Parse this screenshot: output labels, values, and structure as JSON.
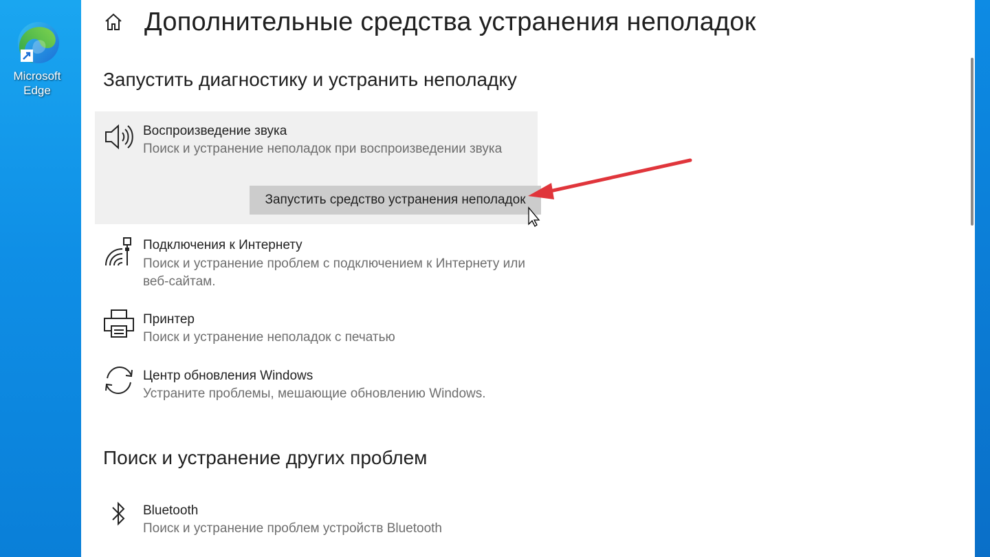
{
  "desktop": {
    "icon_label": "Microsoft Edge",
    "icon": "edge-logo-icon"
  },
  "header": {
    "title": "Дополнительные средства устранения неполадок",
    "home_icon": "home-icon"
  },
  "section_run": {
    "title": "Запустить диагностику и устранить неполадку"
  },
  "items": [
    {
      "icon": "speaker-icon",
      "title": "Воспроизведение звука",
      "description": "Поиск и устранение неполадок при воспроизведении звука",
      "selected": true,
      "button_label": "Запустить средство устранения неполадок"
    },
    {
      "icon": "network-icon",
      "title": "Подключения к Интернету",
      "description": "Поиск и устранение проблем с подключением к Интернету или веб-сайтам."
    },
    {
      "icon": "printer-icon",
      "title": "Принтер",
      "description": "Поиск и устранение неполадок с печатью"
    },
    {
      "icon": "sync-icon",
      "title": "Центр обновления Windows",
      "description": "Устраните проблемы, мешающие обновлению Windows."
    }
  ],
  "section_other": {
    "title": "Поиск и устранение других проблем"
  },
  "other_items": [
    {
      "icon": "bluetooth-icon",
      "title": "Bluetooth",
      "description": "Поиск и устранение проблем устройств Bluetooth"
    }
  ],
  "colors": {
    "accent_arrow": "#e0353b",
    "desktop_bg": "#1296ea",
    "selected_bg": "#f0f0f0",
    "button_bg": "#cccccc"
  }
}
